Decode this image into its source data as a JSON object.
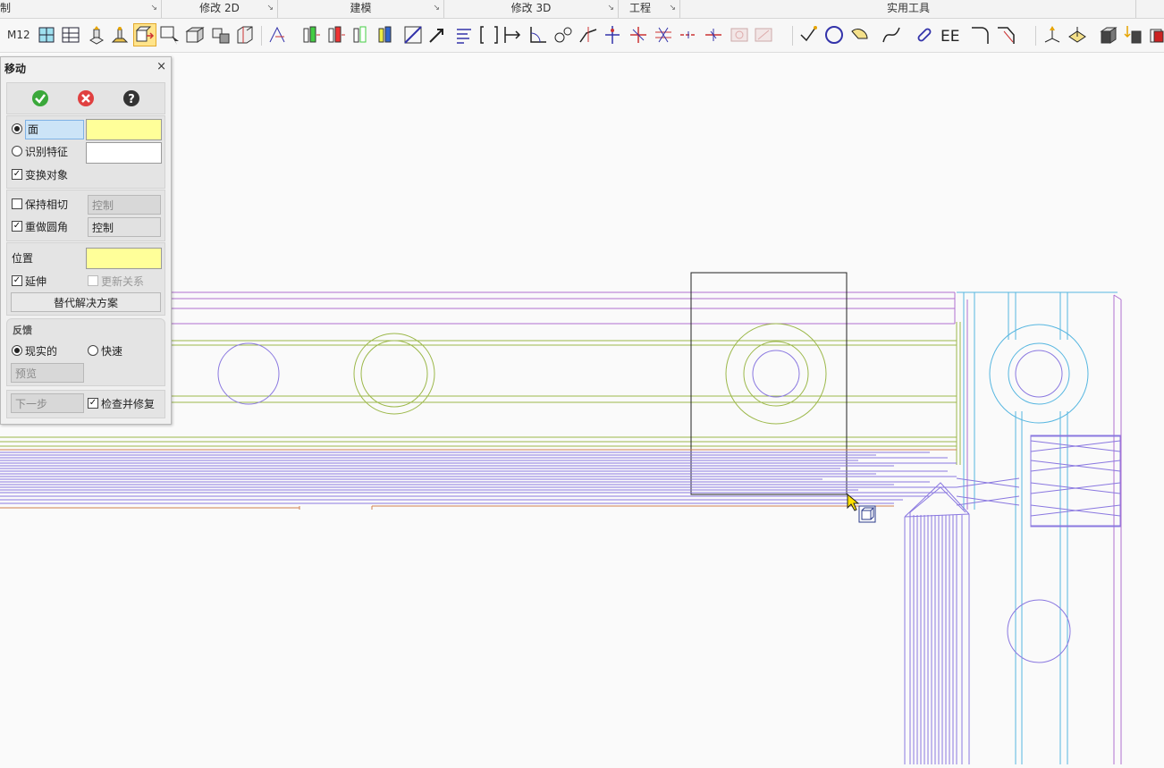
{
  "ribbon": {
    "groups": [
      {
        "label": "制"
      },
      {
        "label": "修改 2D"
      },
      {
        "label": "建模"
      },
      {
        "label": "修改 3D"
      },
      {
        "label": "工程"
      },
      {
        "label": "实用工具"
      }
    ]
  },
  "toolbar": {
    "label": "M12"
  },
  "dialog": {
    "title": "移动",
    "close": "×",
    "ok_icon": "check-icon",
    "cancel_icon": "cancel-icon",
    "help_icon": "help-icon",
    "face_label": "面",
    "identify_label": "识别特征",
    "transform_label": "变换对象",
    "keep_tangent_label": "保持相切",
    "keep_tangent_control": "控制",
    "redo_fillet_label": "重做圆角",
    "redo_fillet_control": "控制",
    "position_label": "位置",
    "extend_label": "延伸",
    "update_relations_label": "更新关系",
    "alt_solutions_label": "替代解决方案",
    "feedback_header": "反馈",
    "realistic_label": "现实的",
    "fast_label": "快速",
    "preview_label": "预览",
    "next_label": "下一步",
    "check_repair_label": "检查并修复"
  },
  "colors": {
    "accent_yellow": "#ffff99",
    "selection_blue": "#cce4f7",
    "wire_purple": "#8a78e0",
    "wire_green": "#9cb84a",
    "wire_cyan": "#56b6e0",
    "wire_magenta": "#b070d0",
    "wire_orange": "#d08050"
  }
}
